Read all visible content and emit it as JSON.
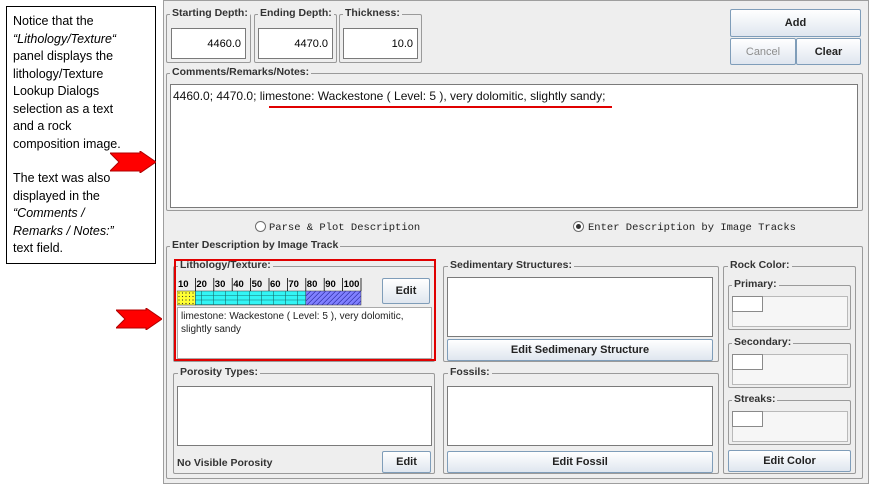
{
  "annotation": {
    "para1": [
      "Notice that the",
      "“Lithology/Texture“",
      "panel displays the",
      "lithology/Texture",
      "Lookup Dialogs",
      "selection as a text",
      "and a rock",
      "composition image."
    ],
    "para2": [
      "The  text was also",
      "displayed in the",
      "“Comments /",
      "Remarks / Notes:”",
      "text field."
    ]
  },
  "header": {
    "starting_depth_label": "Starting Depth:",
    "starting_depth_value": "4460.0",
    "ending_depth_label": "Ending Depth:",
    "ending_depth_value": "4470.0",
    "thickness_label": "Thickness:",
    "thickness_value": "10.0",
    "add_label": "Add",
    "cancel_label": "Cancel",
    "clear_label": "Clear"
  },
  "comments": {
    "label": "Comments/Remarks/Notes:",
    "text": "4460.0; 4470.0; limestone: Wackestone ( Level: 5 ), very dolomitic, slightly sandy;"
  },
  "mode": {
    "option1": "Parse & Plot Description",
    "option2": "Enter Description by Image Tracks",
    "selected": "option2"
  },
  "image_track": {
    "label": "Enter Description by Image Track",
    "lithology": {
      "label": "Lithology/Texture:",
      "scale": [
        "10",
        "20",
        "30",
        "40",
        "50",
        "60",
        "70",
        "80",
        "90",
        "100"
      ],
      "composition": [
        {
          "rock": "sandstone",
          "percent": 10,
          "color": "#ffff33"
        },
        {
          "rock": "limestone",
          "percent": 60,
          "color": "#33f5f5"
        },
        {
          "rock": "dolomite",
          "percent": 30,
          "color": "#8080ff"
        }
      ],
      "edit_label": "Edit",
      "description": "limestone: Wackestone ( Level: 5 ), very dolomitic, slightly sandy"
    },
    "sedimentary": {
      "label": "Sedimentary Structures:",
      "button": "Edit Sedimenary Structure"
    },
    "porosity": {
      "label": "Porosity Types:",
      "status": "No Visible Porosity",
      "button": "Edit"
    },
    "fossils": {
      "label": "Fossils:",
      "button": "Edit Fossil"
    },
    "rock_color": {
      "label": "Rock Color:",
      "primary": "Primary:",
      "secondary": "Secondary:",
      "streaks": "Streaks:",
      "button": "Edit Color"
    }
  },
  "colors": {
    "highlight_red": "#e00000",
    "arrow_red": "#ff0000"
  }
}
